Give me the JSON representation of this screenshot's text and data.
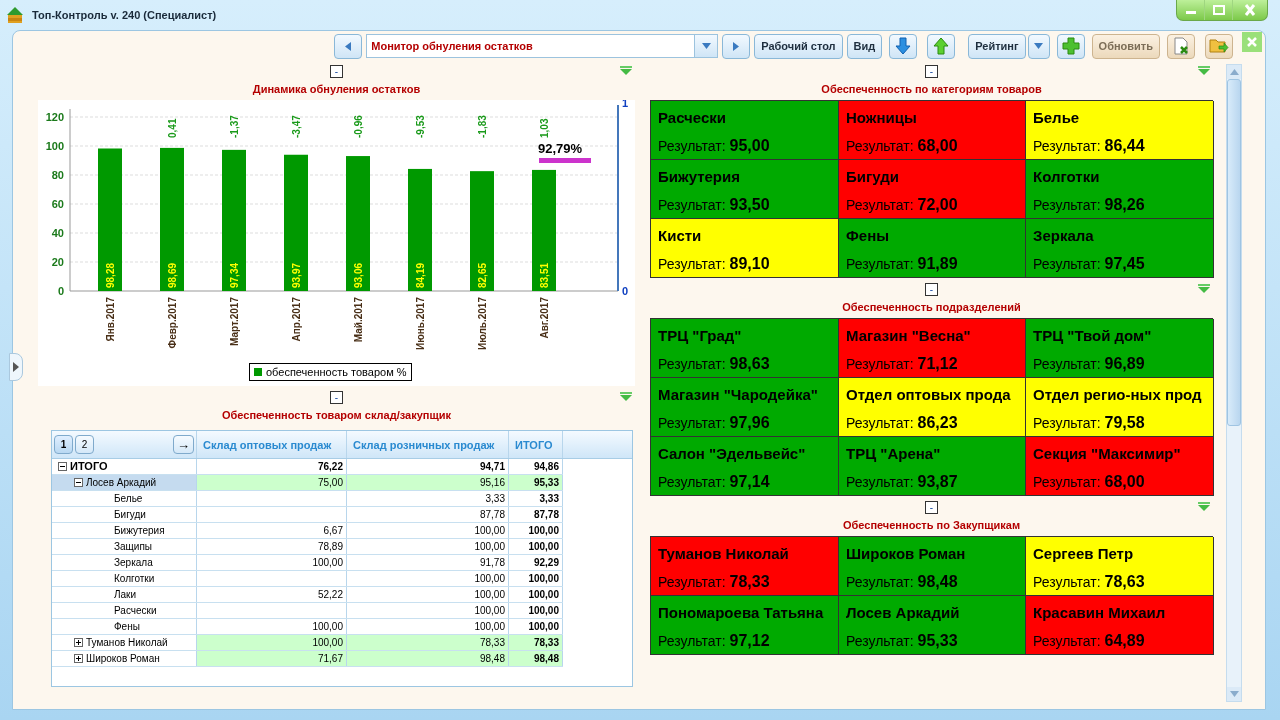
{
  "window": {
    "title": "Топ-Контроль v. 240 (Специалист)"
  },
  "toolbar": [
    {
      "kind": "back",
      "disabled": false
    },
    {
      "kind": "select",
      "value": "Монитор обнуления остатков",
      "disabled": false
    },
    {
      "kind": "forward",
      "disabled": false
    },
    {
      "kind": "button",
      "label": "Рабочий стол",
      "disabled": false
    },
    {
      "kind": "button",
      "label": "Вид",
      "disabled": false
    },
    {
      "kind": "down",
      "disabled": false
    },
    {
      "kind": "up",
      "disabled": false
    },
    {
      "kind": "split",
      "label": "Рейтинг",
      "disabled": false
    },
    {
      "kind": "add",
      "disabled": false
    },
    {
      "kind": "button",
      "label": "Обновить",
      "disabled": true
    },
    {
      "kind": "export",
      "disabled": false
    },
    {
      "kind": "folder",
      "disabled": false
    }
  ],
  "chart_section": {
    "collapse_label": "-",
    "chart_data": {
      "type": "bar",
      "title": "Динамика обнуления остатков",
      "categories": [
        "Янв.2017",
        "Февр.2017",
        "Март.2017",
        "Апр.2017",
        "Май.2017",
        "Июнь.2017",
        "Июль.2017",
        "Авг.2017"
      ],
      "series": [
        {
          "name": "обеспеченность товаром %",
          "color": "#009900",
          "values": [
            98.28,
            98.69,
            97.34,
            93.97,
            93.06,
            84.19,
            82.65,
            83.51
          ]
        }
      ],
      "value_labels": [
        "98,28",
        "98,69",
        "97,34",
        "93,97",
        "93,06",
        "84,19",
        "82,65",
        "83,51"
      ],
      "ylim": [
        0,
        120
      ],
      "yticks": [
        0,
        20,
        40,
        60,
        80,
        100,
        120
      ],
      "y2lim": [
        0,
        1
      ],
      "y2ticks": [
        0,
        1
      ],
      "grid": true,
      "annotations": [
        "0,41",
        "-1,37",
        "-3,47",
        "-0,96",
        "-9,53",
        "-1,83",
        "1,03"
      ]
    },
    "target_label": "92,79%"
  },
  "table_section": {
    "collapse_label": "-",
    "title": "Обеспеченность товаром склад/закупщик",
    "pages": [
      {
        "label": "1",
        "selected": true
      },
      {
        "label": "2",
        "selected": false
      }
    ],
    "arrow_label": "→",
    "columns": [
      "Склад оптовых продаж",
      "Склад розничных продаж",
      "ИТОГО"
    ],
    "rows": [
      {
        "label": "ИТОГО",
        "expanded": true,
        "selected": false,
        "wholesale": "76,22",
        "retail": "94,71",
        "total": "94,86",
        "children": [
          {
            "label": "Лосев Аркадий",
            "expanded": true,
            "selected": true,
            "wholesale": "75,00",
            "retail": "95,16",
            "total": "95,33",
            "children": [
              {
                "label": "Белье",
                "selected": false,
                "retail": "3,33",
                "total": "3,33"
              },
              {
                "label": "Бигуди",
                "selected": false,
                "retail": "87,78",
                "total": "87,78"
              },
              {
                "label": "Бижутерия",
                "selected": false,
                "wholesale": "6,67",
                "retail": "100,00",
                "total": "100,00"
              },
              {
                "label": "Защипы",
                "selected": false,
                "wholesale": "78,89",
                "retail": "100,00",
                "total": "100,00"
              },
              {
                "label": "Зеркала",
                "selected": false,
                "wholesale": "100,00",
                "retail": "91,78",
                "total": "92,29"
              },
              {
                "label": "Колготки",
                "selected": false,
                "retail": "100,00",
                "total": "100,00"
              },
              {
                "label": "Лаки",
                "selected": false,
                "wholesale": "52,22",
                "retail": "100,00",
                "total": "100,00"
              },
              {
                "label": "Расчески",
                "selected": false,
                "retail": "100,00",
                "total": "100,00"
              },
              {
                "label": "Фены",
                "selected": false,
                "wholesale": "100,00",
                "retail": "100,00",
                "total": "100,00"
              }
            ]
          },
          {
            "label": "Туманов Николай",
            "expanded": false,
            "selected": false,
            "wholesale": "100,00",
            "retail": "78,33",
            "total": "78,33"
          },
          {
            "label": "Широков Роман",
            "expanded": false,
            "selected": false,
            "wholesale": "71,67",
            "retail": "98,48",
            "total": "98,48"
          }
        ]
      }
    ]
  },
  "tile_sections": [
    {
      "collapse_label": "-",
      "title": "Обеспеченность по категориям товаров",
      "tiles": [
        {
          "name": "Расчески",
          "result_label": "Результат:",
          "result": "95,00",
          "color": "#00aa00"
        },
        {
          "name": "Ножницы",
          "result_label": "Результат:",
          "result": "68,00",
          "color": "#ff0000"
        },
        {
          "name": "Белье",
          "result_label": "Результат:",
          "result": "86,44",
          "color": "#ffff00"
        },
        {
          "name": "Бижутерия",
          "result_label": "Результат:",
          "result": "93,50",
          "color": "#00aa00"
        },
        {
          "name": "Бигуди",
          "result_label": "Результат:",
          "result": "72,00",
          "color": "#ff0000"
        },
        {
          "name": "Колготки",
          "result_label": "Результат:",
          "result": "98,26",
          "color": "#00aa00"
        },
        {
          "name": "Кисти",
          "result_label": "Результат:",
          "result": "89,10",
          "color": "#ffff00"
        },
        {
          "name": "Фены",
          "result_label": "Результат:",
          "result": "91,89",
          "color": "#00aa00"
        },
        {
          "name": "Зеркала",
          "result_label": "Результат:",
          "result": "97,45",
          "color": "#00aa00"
        }
      ]
    },
    {
      "collapse_label": "-",
      "title": "Обеспеченность подразделений",
      "tiles": [
        {
          "name": "ТРЦ \"Град\"",
          "result_label": "Результат:",
          "result": "98,63",
          "color": "#00aa00"
        },
        {
          "name": "Магазин \"Весна\"",
          "result_label": "Результат:",
          "result": "71,12",
          "color": "#ff0000"
        },
        {
          "name": "ТРЦ \"Твой дом\"",
          "result_label": "Результат:",
          "result": "96,89",
          "color": "#00aa00"
        },
        {
          "name": "Магазин \"Чародейка\"",
          "result_label": "Результат:",
          "result": "97,96",
          "color": "#00aa00"
        },
        {
          "name": "Отдел оптовых прода",
          "result_label": "Результат:",
          "result": "86,23",
          "color": "#ffff00"
        },
        {
          "name": "Отдел регио-ных прод",
          "result_label": "Результат:",
          "result": "79,58",
          "color": "#ffff00"
        },
        {
          "name": "Салон \"Эдельвейс\"",
          "result_label": "Результат:",
          "result": "97,14",
          "color": "#00aa00"
        },
        {
          "name": "ТРЦ \"Арена\"",
          "result_label": "Результат:",
          "result": "93,87",
          "color": "#00aa00"
        },
        {
          "name": "Секция \"Максимир\"",
          "result_label": "Результат:",
          "result": "68,00",
          "color": "#ff0000"
        }
      ]
    },
    {
      "collapse_label": "-",
      "title": "Обеспеченность по Закупщикам",
      "tiles": [
        {
          "name": "Туманов Николай",
          "result_label": "Результат:",
          "result": "78,33",
          "color": "#ff0000"
        },
        {
          "name": "Широков Роман",
          "result_label": "Результат:",
          "result": "98,48",
          "color": "#00aa00"
        },
        {
          "name": "Сергеев Петр",
          "result_label": "Результат:",
          "result": "78,63",
          "color": "#ffff00"
        },
        {
          "name": "Пономароева Татьяна",
          "result_label": "Результат:",
          "result": "97,12",
          "color": "#00aa00"
        },
        {
          "name": "Лосев Аркадий",
          "result_label": "Результат:",
          "result": "95,33",
          "color": "#00aa00"
        },
        {
          "name": "Красавин Михаил",
          "result_label": "Результат:",
          "result": "64,89",
          "color": "#ff0000"
        }
      ]
    }
  ]
}
